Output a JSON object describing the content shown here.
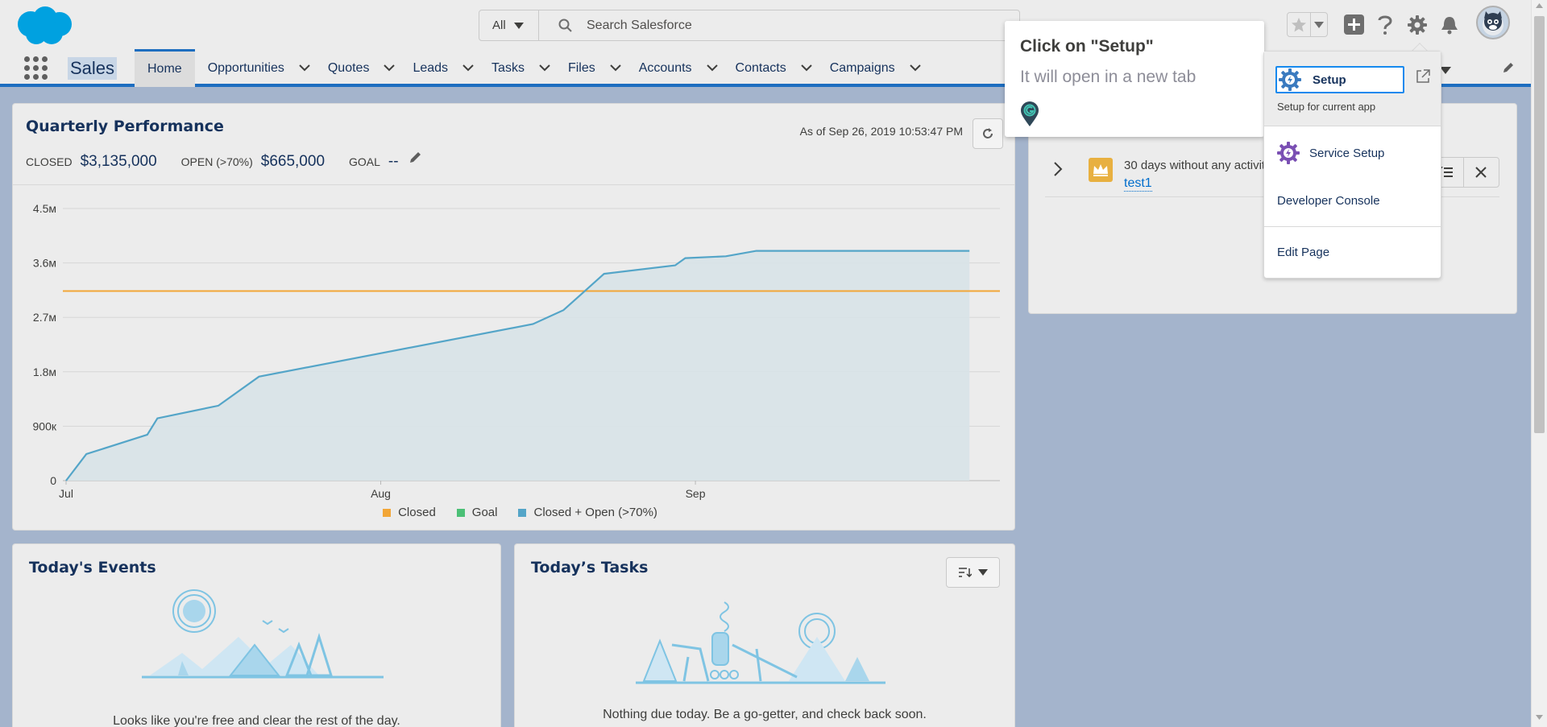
{
  "header": {
    "search": {
      "scope": "All",
      "placeholder": "Search Salesforce"
    }
  },
  "nav": {
    "app_name": "Sales",
    "items": [
      {
        "label": "Home",
        "active": true
      },
      {
        "label": "Opportunities"
      },
      {
        "label": "Quotes"
      },
      {
        "label": "Leads"
      },
      {
        "label": "Tasks"
      },
      {
        "label": "Files"
      },
      {
        "label": "Accounts"
      },
      {
        "label": "Contacts"
      },
      {
        "label": "Campaigns"
      }
    ]
  },
  "performance": {
    "title": "Quarterly Performance",
    "as_of": "As of Sep 26, 2019 10:53:47 PM",
    "closed_label": "CLOSED",
    "closed_value": "$3,135,000",
    "open_label": "OPEN (>70%)",
    "open_value": "$665,000",
    "goal_label": "GOAL",
    "goal_value": "--"
  },
  "chart_data": {
    "type": "area",
    "y_ticks": [
      "0",
      "900к",
      "1.8м",
      "2.7м",
      "3.6м",
      "4.5м"
    ],
    "x_ticks": [
      "Jul",
      "Aug",
      "Sep"
    ],
    "ylim": [
      0,
      4500000
    ],
    "legend": [
      "Closed",
      "Goal",
      "Closed + Open (>70%)"
    ],
    "colors": {
      "closed": "#f2a637",
      "goal": "#4bc076",
      "closed_open": "#54a5c8"
    },
    "goal_value": 3135000,
    "series": [
      {
        "name": "Closed + Open (>70%)",
        "x": [
          "Jul 1",
          "Jul 3",
          "Jul 9",
          "Jul 10",
          "Jul 16",
          "Jul 20",
          "Aug 16",
          "Aug 19",
          "Aug 21",
          "Aug 23",
          "Aug 30",
          "Aug 31",
          "Sep 4",
          "Sep 7",
          "Sep 28"
        ],
        "values": [
          0,
          440000,
          760000,
          1030000,
          1240000,
          1720000,
          2590000,
          2820000,
          3120000,
          3420000,
          3560000,
          3680000,
          3710000,
          3800000,
          3800000
        ]
      }
    ],
    "grid": true,
    "legend_position": "bottom"
  },
  "activity": {
    "text": "30 days without any activity",
    "link": "test1"
  },
  "events": {
    "title": "Today's Events",
    "message": "Looks like you're free and clear the rest of the day."
  },
  "tasks": {
    "title": "Today’s Tasks",
    "message": "Nothing due today. Be a go-getter, and check back soon."
  },
  "tooltip": {
    "title": "Click on \"Setup\"",
    "body": "It will open in a new tab"
  },
  "setup_menu": {
    "setup_label": "Setup",
    "setup_sub": "Setup for current app",
    "service_setup": "Service Setup",
    "developer_console": "Developer Console",
    "edit_page": "Edit Page"
  }
}
